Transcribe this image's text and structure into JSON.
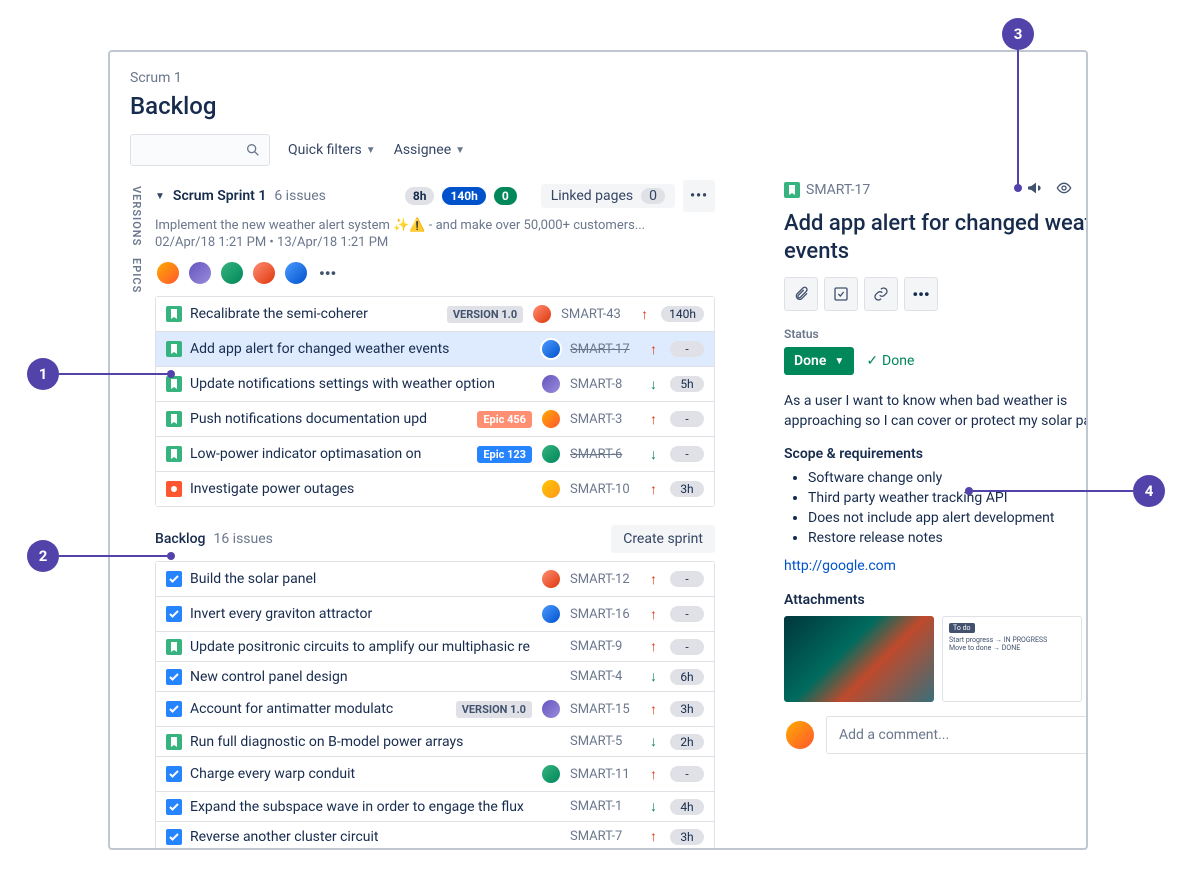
{
  "breadcrumb": "Scrum 1",
  "pageTitle": "Backlog",
  "filters": {
    "quick": "Quick filters",
    "assignee": "Assignee"
  },
  "sideTabs": [
    "VERSIONS",
    "EPICS"
  ],
  "sprint": {
    "name": "Scrum Sprint 1",
    "count": "6 issues",
    "estimates": {
      "todo": "8h",
      "prog": "140h",
      "done": "0"
    },
    "linked": "Linked pages",
    "linkedCount": "0",
    "goal": "Implement the new weather alert system ✨⚠️ - and make over 50,000+ customers...",
    "dates": "02/Apr/18 1:21 PM • 13/Apr/18 1:21 PM",
    "issues": [
      {
        "type": "story",
        "title": "Recalibrate the semi-coherer",
        "ver": "VERSION 1.0",
        "key": "SMART-43",
        "prio": "up",
        "est": "140h",
        "av": "a4"
      },
      {
        "type": "story",
        "title": "Add app alert for changed weather events",
        "key": "SMART-17",
        "prio": "up",
        "est": "-",
        "av": "a5",
        "selected": true,
        "strike": true
      },
      {
        "type": "story",
        "title": "Update notifications settings with weather option",
        "key": "SMART-8",
        "prio": "down",
        "est": "5h",
        "av": "a2"
      },
      {
        "type": "story",
        "title": "Push notifications documentation upd",
        "epic": "Epic 456",
        "epicCls": "epic-pink",
        "key": "SMART-3",
        "prio": "up",
        "est": "-",
        "av": "a1"
      },
      {
        "type": "story",
        "title": "Low-power indicator optimasation on",
        "epic": "Epic 123",
        "epicCls": "epic-blue",
        "key": "SMART-6",
        "prio": "down",
        "est": "-",
        "av": "a3",
        "strike": true
      },
      {
        "type": "bug",
        "title": "Investigate power outages",
        "key": "SMART-10",
        "prio": "up",
        "est": "3h",
        "av": "a6"
      }
    ]
  },
  "backlog": {
    "title": "Backlog",
    "count": "16 issues",
    "create": "Create sprint",
    "issues": [
      {
        "type": "task",
        "title": "Build the solar panel",
        "key": "SMART-12",
        "prio": "up",
        "est": "-",
        "av": "a4"
      },
      {
        "type": "task",
        "title": "Invert every graviton attractor",
        "key": "SMART-16",
        "prio": "up",
        "est": "-",
        "av": "a5"
      },
      {
        "type": "story",
        "title": "Update positronic circuits to amplify our multiphasic re",
        "key": "SMART-9",
        "prio": "up",
        "est": "-"
      },
      {
        "type": "task",
        "title": "New control panel design",
        "key": "SMART-4",
        "prio": "down",
        "est": "6h"
      },
      {
        "type": "task",
        "title": "Account for antimatter modulatc",
        "ver": "VERSION 1.0",
        "key": "SMART-15",
        "prio": "up",
        "est": "3h",
        "av": "a2"
      },
      {
        "type": "story",
        "title": "Run full diagnostic on B-model power arrays",
        "key": "SMART-5",
        "prio": "down",
        "est": "2h"
      },
      {
        "type": "task",
        "title": "Charge every warp conduit",
        "key": "SMART-11",
        "prio": "up",
        "est": "-",
        "av": "a3"
      },
      {
        "type": "task",
        "title": "Expand the subspace wave in order to engage the flux",
        "key": "SMART-1",
        "prio": "down",
        "est": "4h"
      },
      {
        "type": "task",
        "title": "Reverse another cluster circuit",
        "key": "SMART-7",
        "prio": "up",
        "est": "3h"
      }
    ]
  },
  "detail": {
    "key": "SMART-17",
    "title": "Add app alert for changed weather events",
    "statusLabel": "Status",
    "statusValue": "Done",
    "statusText": "Done",
    "desc": "As a user I want to know when bad weather is approaching so I can cover or protect my solar panels.",
    "scopeTitle": "Scope & requirements",
    "scope": [
      "Software change only",
      "Third party weather tracking API",
      "Does not include app alert development",
      "Restore release notes"
    ],
    "link": "http://google.com",
    "attachTitle": "Attachments",
    "th2": {
      "badge": "To do",
      "l1": "Start progress → IN PROGRESS",
      "l2": "Move to done → DONE"
    },
    "commentPlaceholder": "Add a comment..."
  },
  "annotations": [
    "1",
    "2",
    "3",
    "4"
  ]
}
